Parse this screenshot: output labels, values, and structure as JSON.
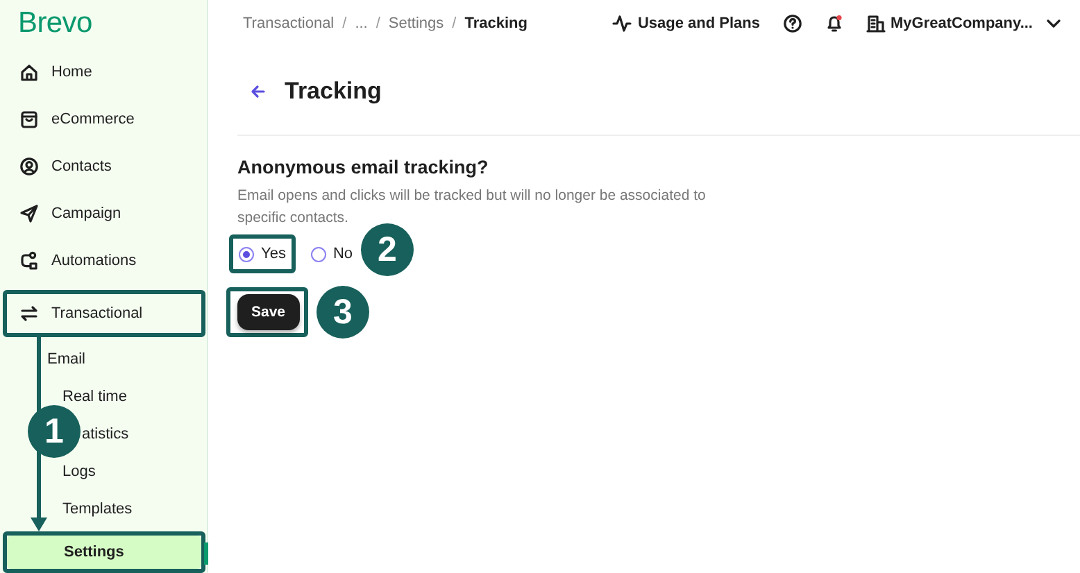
{
  "sidebar": {
    "logo": "Brevo",
    "items": [
      {
        "label": "Home",
        "highlighted": false
      },
      {
        "label": "eCommerce",
        "highlighted": false
      },
      {
        "label": "Contacts",
        "highlighted": false
      },
      {
        "label": "Campaign",
        "highlighted": false
      },
      {
        "label": "Automations",
        "highlighted": false
      },
      {
        "label": "Transactional",
        "highlighted": true,
        "children": [
          {
            "label": "Email",
            "children": [
              {
                "label": "Real time",
                "selected": false,
                "highlighted": false
              },
              {
                "label": "atistics",
                "selected": false,
                "highlighted": false
              },
              {
                "label": "Logs",
                "selected": false,
                "highlighted": false
              },
              {
                "label": "Templates",
                "selected": false,
                "highlighted": false
              },
              {
                "label": "Settings",
                "selected": true,
                "highlighted": true
              }
            ]
          }
        ]
      }
    ]
  },
  "header": {
    "breadcrumb": [
      {
        "label": "Transactional",
        "current": false
      },
      {
        "label": "...",
        "current": false
      },
      {
        "label": "Settings",
        "current": false
      },
      {
        "label": "Tracking",
        "current": true
      }
    ],
    "separator": "/",
    "usage": "Usage and Plans",
    "company": "MyGreatCompany...",
    "notification": true
  },
  "page": {
    "title": "Tracking",
    "question": "Anonymous email tracking?",
    "description": "Email opens and clicks will be tracked but will no longer be associated to specific contacts.",
    "options": [
      {
        "label": "Yes",
        "selected": true,
        "highlighted": true
      },
      {
        "label": "No",
        "selected": false,
        "highlighted": false
      }
    ],
    "save": {
      "label": "Save",
      "highlighted": true
    }
  },
  "callouts": [
    {
      "number": "1"
    },
    {
      "number": "2"
    },
    {
      "number": "3"
    }
  ]
}
